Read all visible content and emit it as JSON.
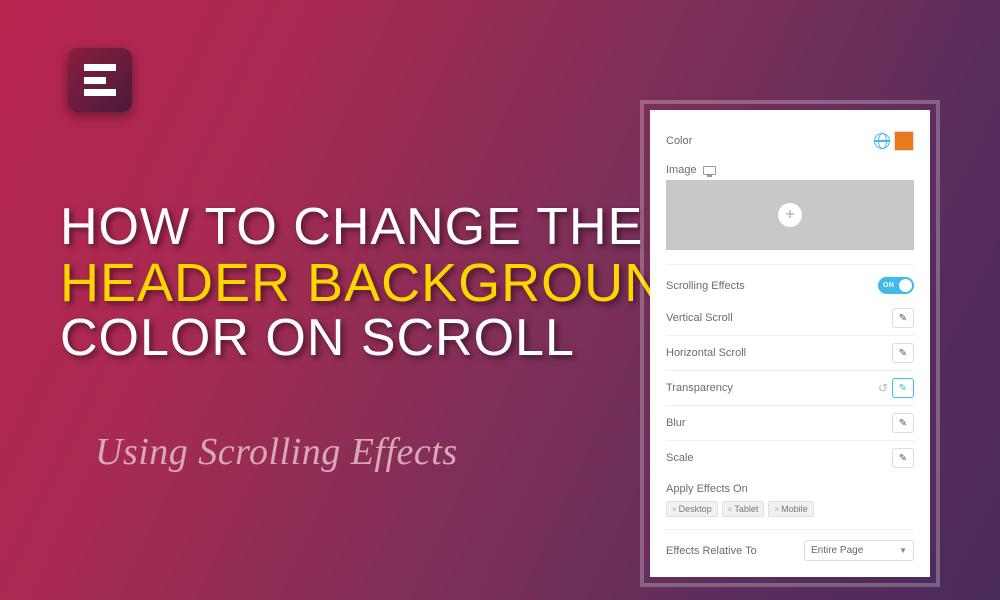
{
  "logo": {
    "name": "elementor"
  },
  "title": {
    "line1": "How to change the",
    "line2": "Header Background",
    "line3": "Color on Scroll"
  },
  "subtitle": "Using Scrolling Effects",
  "panel": {
    "color_label": "Color",
    "color_value": "#e8791d",
    "image_label": "Image",
    "scrolling_effects_label": "Scrolling Effects",
    "scrolling_effects_on": "ON",
    "effects": {
      "vertical": "Vertical Scroll",
      "horizontal": "Horizontal Scroll",
      "transparency": "Transparency",
      "blur": "Blur",
      "scale": "Scale"
    },
    "apply_effects_label": "Apply Effects On",
    "tags": [
      "Desktop",
      "Tablet",
      "Mobile"
    ],
    "relative_label": "Effects Relative To",
    "relative_value": "Entire Page"
  }
}
